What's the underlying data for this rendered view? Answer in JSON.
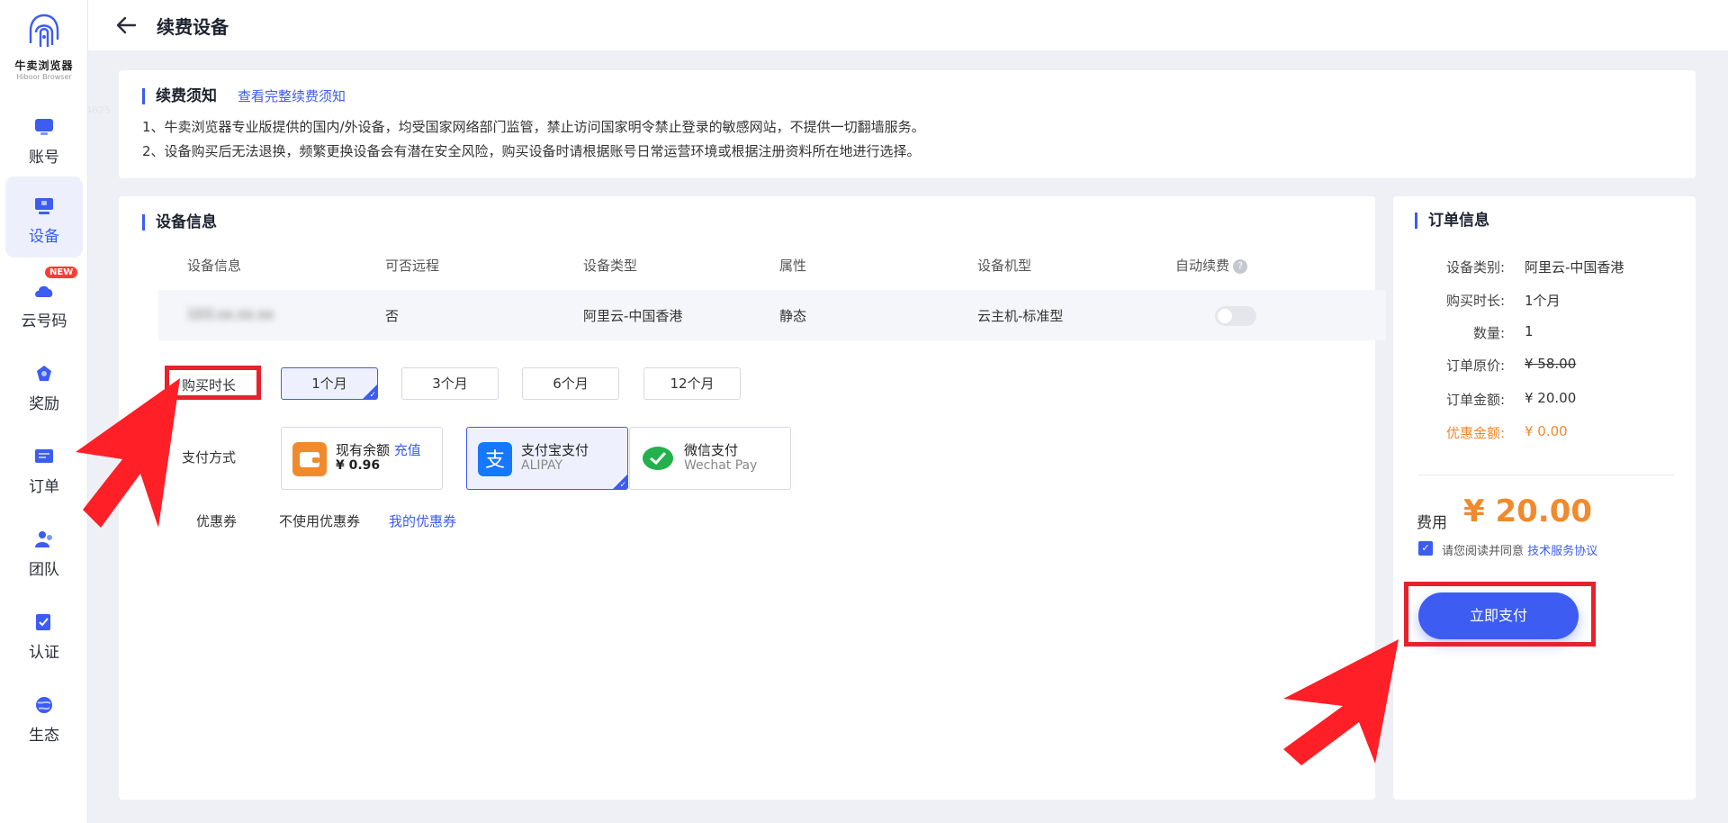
{
  "brand": {
    "name_cn": "牛卖浏览器",
    "name_en": "Hiboor Browser"
  },
  "sidebar": {
    "items": [
      {
        "label": "账号",
        "icon": "account-icon",
        "active": false
      },
      {
        "label": "设备",
        "icon": "device-icon",
        "active": true
      },
      {
        "label": "云号码",
        "icon": "cloud-number-icon",
        "active": false,
        "badge": "NEW"
      },
      {
        "label": "奖励",
        "icon": "reward-icon",
        "active": false
      },
      {
        "label": "订单",
        "icon": "order-icon",
        "active": false
      },
      {
        "label": "团队",
        "icon": "team-icon",
        "active": false
      },
      {
        "label": "认证",
        "icon": "verify-icon",
        "active": false
      },
      {
        "label": "生态",
        "icon": "ecosystem-icon",
        "active": false
      }
    ]
  },
  "header": {
    "title": "续费设备"
  },
  "notice": {
    "title": "续费须知",
    "link": "查看完整续费须知",
    "lines": [
      "1、牛卖浏览器专业版提供的国内/外设备，均受国家网络部门监管，禁止访问国家明令禁止登录的敏感网站，不提供一切翻墙服务。",
      "2、设备购买后无法退换，频繁更换设备会有潜在安全风险，购买设备时请根据账号日常运营环境或根据注册资料所在地进行选择。"
    ]
  },
  "device": {
    "title": "设备信息",
    "columns": [
      "设备信息",
      "可否远程",
      "设备类型",
      "属性",
      "设备机型",
      "自动续费"
    ],
    "row": {
      "info": "103.xx.xx.xx",
      "remote": "否",
      "type": "阿里云-中国香港",
      "attr": "静态",
      "model": "云主机-标准型"
    },
    "auto_renew": false,
    "duration_label": "购买时长",
    "durations": [
      "1个月",
      "3个月",
      "6个月",
      "12个月"
    ],
    "selected_duration": "1个月",
    "payment_label": "支付方式",
    "payments": {
      "balance": {
        "title": "现有余额",
        "recharge": "充值",
        "amount": "¥ 0.96"
      },
      "alipay": {
        "title": "支付宝支付",
        "sub": "ALIPAY",
        "selected": true
      },
      "wechat": {
        "title": "微信支付",
        "sub": "Wechat Pay"
      }
    },
    "coupon_label": "优惠券",
    "coupon_value": "不使用优惠券",
    "coupon_link": "我的优惠券"
  },
  "order": {
    "title": "订单信息",
    "rows": [
      {
        "k": "设备类别:",
        "v": "阿里云-中国香港"
      },
      {
        "k": "购买时长:",
        "v": "1个月"
      },
      {
        "k": "数量:",
        "v": "1"
      },
      {
        "k": "订单原价:",
        "v": "¥ 58.00"
      },
      {
        "k": "订单金额:",
        "v": "¥ 20.00"
      },
      {
        "k": "优惠金额:",
        "v": "¥ 0.00"
      }
    ],
    "fee_label": "费用",
    "fee_value": "¥ 20.00",
    "agree_text": "请您阅读并同意",
    "agree_link": "技术服务协议",
    "pay_button": "立即支付"
  },
  "colors": {
    "accent": "#3c5cf2",
    "orange": "#f08a2c",
    "highlight": "#e8212a"
  }
}
